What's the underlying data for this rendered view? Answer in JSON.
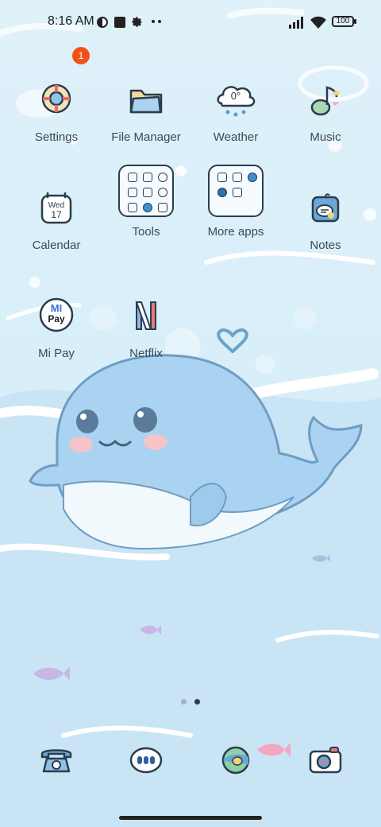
{
  "status_bar": {
    "time": "8:16 AM",
    "battery": "100",
    "icons": [
      "app-icon",
      "square-icon",
      "gear-icon",
      "more-dots-icon",
      "signal-icon",
      "wifi-icon",
      "battery-icon"
    ]
  },
  "apps": [
    {
      "label": "Settings",
      "badge": "1"
    },
    {
      "label": "File Manager"
    },
    {
      "label": "Weather",
      "temp": "0°"
    },
    {
      "label": "Music"
    },
    {
      "label": "Calendar",
      "day": "Wed",
      "date": "17"
    },
    {
      "label": "Tools"
    },
    {
      "label": "More apps"
    },
    {
      "label": "Notes"
    },
    {
      "label": "Mi Pay",
      "logo_top": "MI",
      "logo_bottom": "Pay"
    },
    {
      "label": "Netflix"
    }
  ],
  "page_indicator": {
    "pages": 2,
    "active": 2
  },
  "dock": [
    "phone-icon",
    "messages-icon",
    "browser-icon",
    "camera-icon"
  ],
  "colors": {
    "badge": "#f05318",
    "ink": "#2b3d4c",
    "accent_blue": "#3d8fd6"
  }
}
